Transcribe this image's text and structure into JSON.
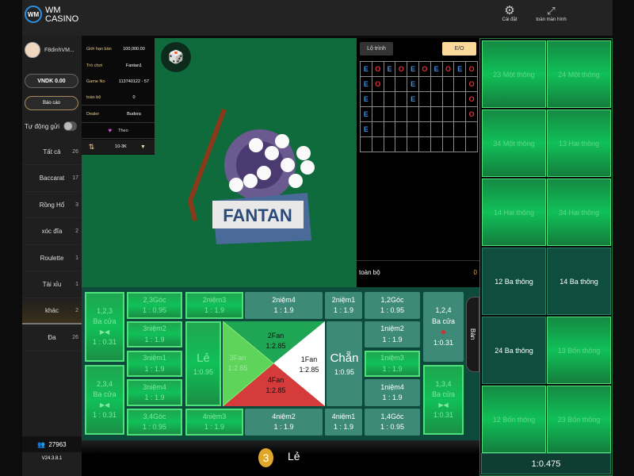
{
  "brand": {
    "logo_text": "WM",
    "name_line1": "WM",
    "name_line2": "CASINO"
  },
  "header": {
    "settings_label": "Cài đặt",
    "fullscreen_label": "toàn màn hình"
  },
  "user": {
    "name": "F8dinhVM...",
    "balance": "VNDK 0.00",
    "report": "Báo cáo",
    "auto_send": "Tự động gửi",
    "auto_send_on": false
  },
  "sidebar": {
    "items": [
      {
        "label": "Tất cả",
        "count": "26"
      },
      {
        "label": "Baccarat",
        "count": "17"
      },
      {
        "label": "Rồng Hổ",
        "count": "3"
      },
      {
        "label": "xóc đĩa",
        "count": "2"
      },
      {
        "label": "Roulette",
        "count": "1"
      },
      {
        "label": "Tài xỉu",
        "count": "1"
      },
      {
        "label": "khác",
        "count": "2",
        "active": true
      },
      {
        "label": "Đa",
        "count": "26"
      }
    ],
    "online_count": "27963",
    "version": "V24.3.8.1"
  },
  "info": {
    "limit_label": "Giới hạn bàn",
    "limit_value": "100,000.00",
    "game_label": "Trò chơi",
    "game_value": "Fantan1",
    "gameno_label": "Game No",
    "gameno_value": "113740122 - 57",
    "total_label": "toàn bộ",
    "total_value": "0",
    "dealer_label": "Dealer",
    "dealer_value": "Budora",
    "follow_label": "Theo",
    "chip_range": "10-3K"
  },
  "video": {
    "logo_text": "FANTAN"
  },
  "road": {
    "tab_route": "Lộ trình",
    "tab_eo": "E/O",
    "total_label": "toàn bộ",
    "total_value": "0",
    "grid": [
      [
        "E",
        "O",
        "E",
        "O",
        "E",
        "O",
        "E",
        "O",
        "E",
        "O"
      ],
      [
        "E",
        "O",
        "",
        "",
        "E",
        "",
        "",
        "",
        "",
        "O"
      ],
      [
        "E",
        "",
        "",
        "",
        "E",
        "",
        "",
        "",
        "",
        "O"
      ],
      [
        "E",
        "",
        "",
        "",
        "",
        "",
        "",
        "",
        "",
        "O"
      ],
      [
        "E",
        "",
        "",
        "",
        "",
        "",
        "",
        "",
        "",
        ""
      ],
      [
        "",
        "",
        "",
        "",
        "",
        "",
        "",
        "",
        "",
        ""
      ]
    ],
    "colors": {
      "E": "#3a8ee6",
      "O": "#e0303a"
    }
  },
  "bets": {
    "b123": {
      "name": "1,2,3",
      "sub": "Ba cửa",
      "odds": "1 : 0.31"
    },
    "b234": {
      "name": "2,3,4",
      "sub": "Ba cửa",
      "odds": "1 : 0.31"
    },
    "g23": {
      "name": "2,3Góc",
      "odds": "1 : 0.95"
    },
    "n32": {
      "name": "3niệm2",
      "odds": "1 : 1.9"
    },
    "n31": {
      "name": "3niệm1",
      "odds": "1 : 1.9"
    },
    "n34": {
      "name": "3niệm4",
      "odds": "1 : 1.9"
    },
    "g34": {
      "name": "3,4Góc",
      "odds": "1 : 0.95"
    },
    "n23": {
      "name": "2niệm3",
      "odds": "1 : 1.9"
    },
    "le": {
      "name": "Lẻ",
      "odds": "1:0.95"
    },
    "n43": {
      "name": "4niệm3",
      "odds": "1 : 1.9"
    },
    "n24": {
      "name": "2niệm4",
      "odds": "1 : 1.9"
    },
    "n21": {
      "name": "2niệm1",
      "odds": "1 : 1.9"
    },
    "n42": {
      "name": "4niệm2",
      "odds": "1 : 1.9"
    },
    "n41": {
      "name": "4niệm1",
      "odds": "1 : 1.9"
    },
    "fan1": {
      "name": "1Fan",
      "odds": "1:2.85"
    },
    "fan2": {
      "name": "2Fan",
      "odds": "1:2.85"
    },
    "fan3": {
      "name": "3Fan",
      "odds": "1:2.85"
    },
    "fan4": {
      "name": "4Fan",
      "odds": "1:2.85"
    },
    "chan": {
      "name": "Chẵn",
      "odds": "1:0.95"
    },
    "g12": {
      "name": "1,2Góc",
      "odds": "1 : 0.95"
    },
    "n12": {
      "name": "1niệm2",
      "odds": "1 : 1.9"
    },
    "n13": {
      "name": "1niệm3",
      "odds": "1 : 1.9"
    },
    "n14": {
      "name": "1niệm4",
      "odds": "1 : 1.9"
    },
    "g14": {
      "name": "1,4Góc",
      "odds": "1 : 0.95"
    },
    "b124": {
      "name": "1,2,4",
      "sub": "Ba cửa",
      "odds": "1:0.31"
    },
    "b134": {
      "name": "1,3,4",
      "sub": "Ba cửa",
      "odds": "1:0.31"
    },
    "table_tab": "Bàn"
  },
  "result": {
    "number": "3",
    "label": "Lẻ"
  },
  "right": {
    "cells": [
      "23 Một thông",
      "24 Một thông",
      "34 Một thông",
      "13 Hai thông",
      "14 Hai thông",
      "34 Hai thông",
      "12 Ba thông",
      "14 Ba thông",
      "24 Ba thông",
      "13 Bốn thông",
      "12 Bốn thông",
      "23 Bốn thông"
    ],
    "highlighted": [
      true,
      true,
      true,
      true,
      true,
      true,
      false,
      false,
      false,
      true,
      true,
      true
    ],
    "odds": "1:0.475"
  }
}
